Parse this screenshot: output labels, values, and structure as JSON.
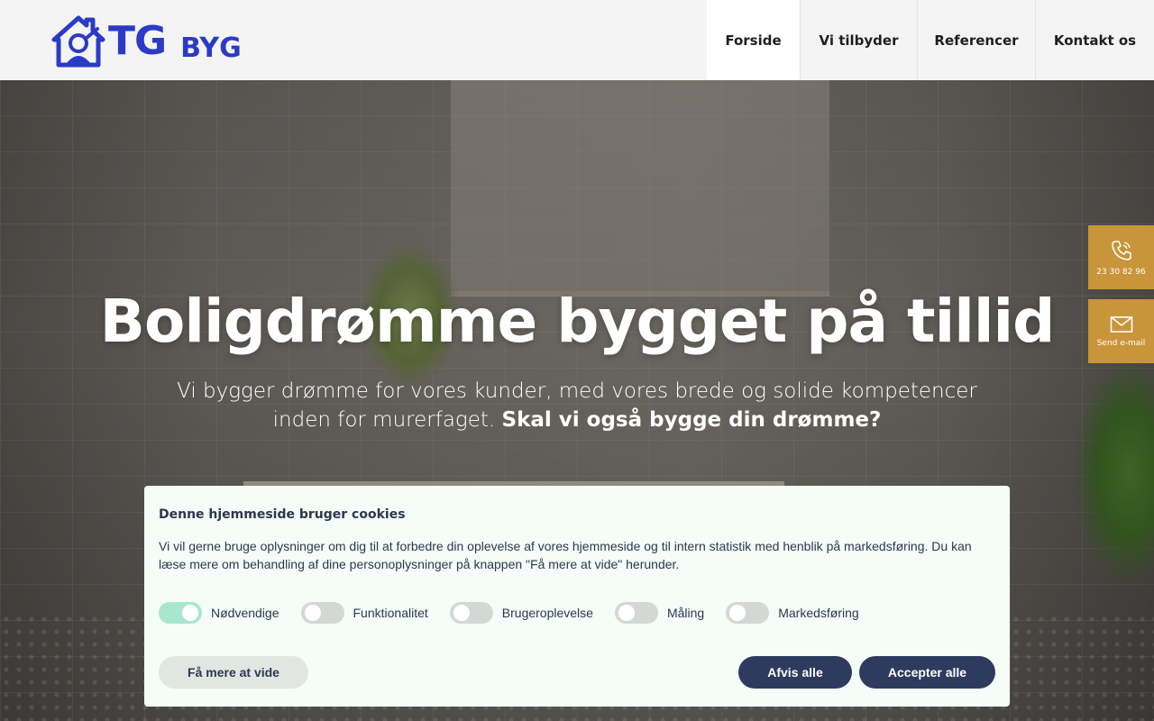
{
  "brand": {
    "logo_tg": "TG",
    "logo_byg": "BYG",
    "color": "#2b3bc6"
  },
  "nav": [
    {
      "label": "Forside",
      "active": true
    },
    {
      "label": "Vi tilbyder",
      "active": false
    },
    {
      "label": "Referencer",
      "active": false
    },
    {
      "label": "Kontakt os",
      "active": false
    }
  ],
  "hero": {
    "title": "Boligdrømme bygget på tillid",
    "subtitle_line1": "Vi bygger drømme for vores kunder, med vores brede og solide kompetencer",
    "subtitle_line2": "inden for murerfaget.",
    "subtitle_bold": "Skal vi også bygge din drømme?"
  },
  "side_contact": {
    "phone": {
      "icon": "phone-icon",
      "label": "23 30 82 96"
    },
    "email": {
      "icon": "envelope-icon",
      "label": "Send e-mail"
    },
    "color": "#c9953a"
  },
  "cookie": {
    "title": "Denne hjemmeside bruger cookies",
    "text": "Vi vil gerne bruge oplysninger om dig til at forbedre din oplevelse af vores hjemmeside og til intern statistik med henblik på markedsføring. Du kan læse mere om behandling af dine personoplysninger på knappen \"Få mere at vide\" herunder.",
    "toggles": [
      {
        "label": "Nødvendige",
        "on": true
      },
      {
        "label": "Funktionalitet",
        "on": false
      },
      {
        "label": "Brugeroplevelse",
        "on": false
      },
      {
        "label": "Måling",
        "on": false
      },
      {
        "label": "Markedsføring",
        "on": false
      }
    ],
    "more_label": "Få mere at vide",
    "reject_label": "Afvis alle",
    "accept_label": "Accepter alle"
  }
}
